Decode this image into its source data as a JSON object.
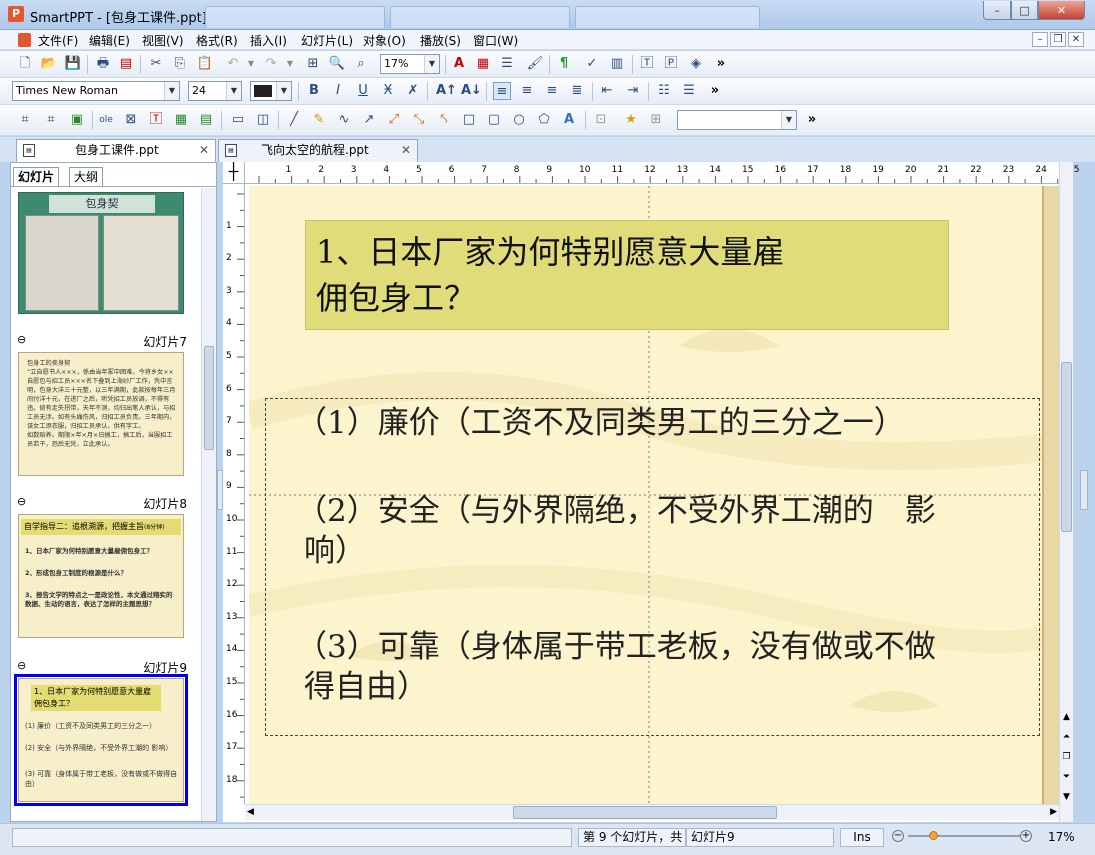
{
  "window": {
    "title": "SmartPPT - [包身工课件.ppt]"
  },
  "menu": [
    "文件(F)",
    "编辑(E)",
    "视图(V)",
    "格式(R)",
    "插入(I)",
    "幻灯片(L)",
    "对象(O)",
    "播放(S)",
    "窗口(W)"
  ],
  "toolbar": {
    "zoom": "17%",
    "font_name": "Times New Roman",
    "font_size": "24",
    "more": "»"
  },
  "doc_tabs": [
    {
      "label": "包身工课件.ppt",
      "close": "✕"
    },
    {
      "label": "飞向太空的航程.ppt",
      "close": "✕"
    }
  ],
  "panel_tabs": {
    "slides": "幻灯片",
    "outline": "大纲"
  },
  "thumbs": {
    "slide6_title": "包身契",
    "slide7": {
      "label": "幻灯片7",
      "text": "包身工的卖身契\n“立自愿书人×××，係由当年冢中困难，今将乡女××自愿包与招工员×××名下叠到上海纱厂工作，凭中言明，包身大洋三十元整，以三年满期，此款按每年三月间付洋十元，在进厂之后，听凭招工员放调，不得有违。倘有走失拐带，天年不测，均归出笔人承认，与招工员无涉。如有头痛伤风，归招工员负责。三年期内，该女工添衣服，归招工员承认，供有字工。\n如数赔养。期限×年×月×日搞工，搞工后，当服招工员若干，恐后无凭，立此承认。"
    },
    "slide8": {
      "label": "幻灯片8",
      "title": "自学指导二：追根溯源，把握主旨",
      "badge": "(8分钟)",
      "items": [
        "1、日本厂家为何特别愿意大量雇佣包身工？",
        "2、形成包身工制度的根源是什么？",
        "3、报告文学的特点之一是政论性，本文通过翔实的数据、生动的语言，表达了怎样的主题思想？"
      ]
    },
    "slide9": {
      "label": "幻灯片9",
      "title": "1、日本厂家为何特别愿意大量雇佣包身工？",
      "items": [
        "(1) 廉价（工资不及同类男工的三分之一）",
        "(2) 安全（与外界隔绝，不受外界工潮的 影响）",
        "(3) 可靠（身体属于带工老板，没有做或不做得自由）"
      ]
    }
  },
  "slide": {
    "title_line1": "1、日本厂家为何特别愿意大量雇",
    "title_line2": "佣包身工？",
    "items": [
      {
        "line1": "（1）廉价（工资不及同类男工的三分之一）",
        "line2": ""
      },
      {
        "line1": "（2）安全（与外界隔绝，不受外界工潮的　影",
        "line2": "响）"
      },
      {
        "line1": "（3）可靠（身体属于带工老板，没有做或不做",
        "line2": "得自由）"
      }
    ]
  },
  "ruler": {
    "top": [
      "1",
      "2",
      "3",
      "4",
      "5",
      "6",
      "7",
      "8",
      "9",
      "10",
      "11",
      "12",
      "13",
      "14",
      "15",
      "16",
      "17",
      "18",
      "19",
      "20",
      "21",
      "22",
      "23",
      "24",
      "25"
    ],
    "left": [
      "1",
      "2",
      "3",
      "4",
      "5",
      "6",
      "7",
      "8",
      "9",
      "10",
      "11",
      "12",
      "13",
      "14",
      "15",
      "16",
      "17",
      "18"
    ]
  },
  "status": {
    "slide_pos": "第 9 个幻灯片，共",
    "slide_name": "幻灯片9",
    "mode": "Ins",
    "zoom": "17%"
  }
}
